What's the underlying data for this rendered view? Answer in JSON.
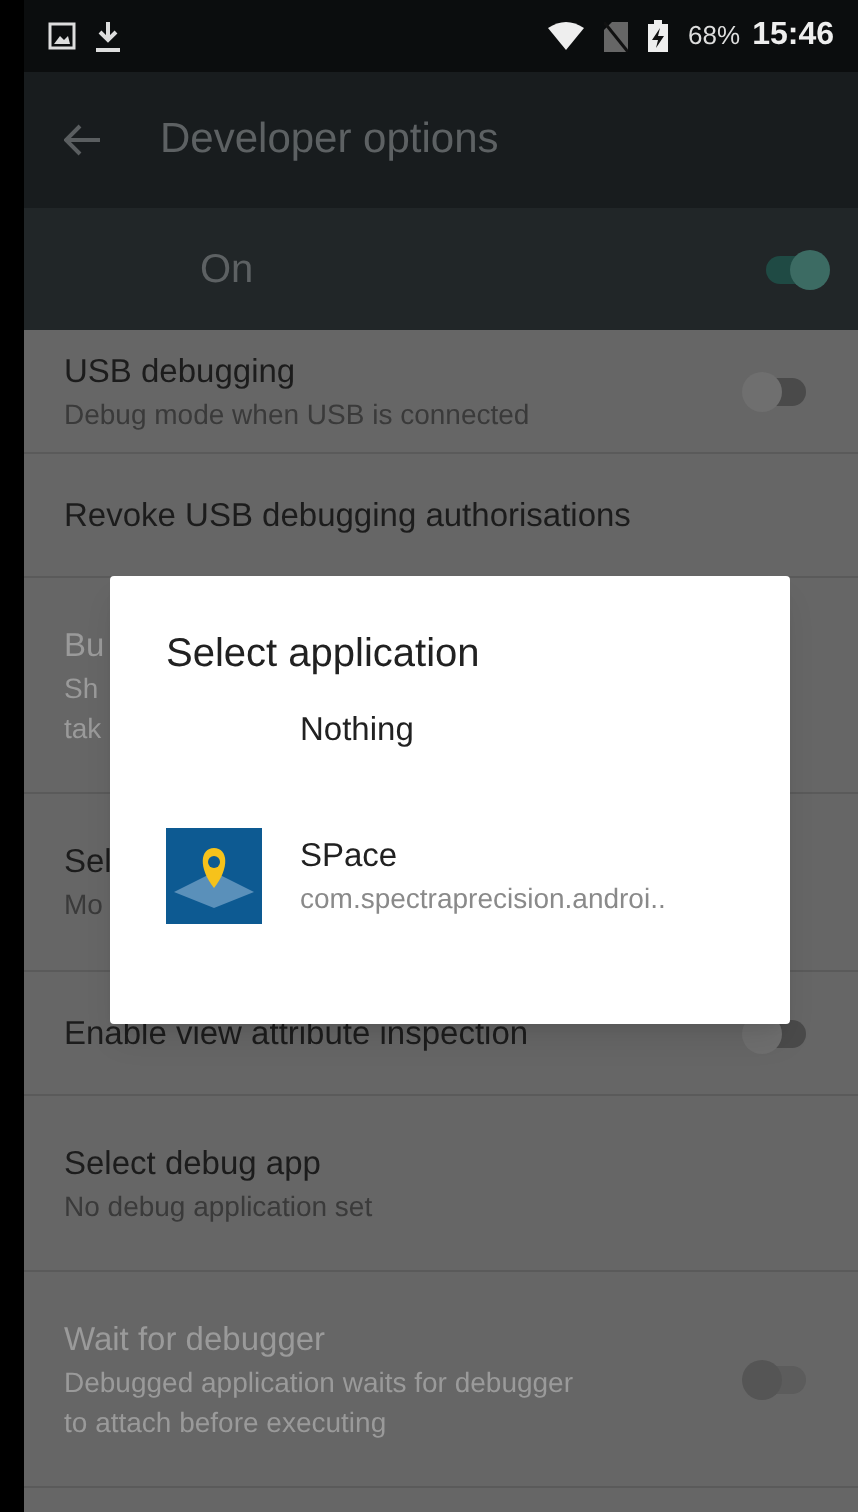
{
  "status_bar": {
    "battery": "68%",
    "time": "15:46"
  },
  "toolbar": {
    "title": "Developer options"
  },
  "master_switch": {
    "label": "On",
    "on": true
  },
  "settings": [
    {
      "kind": "switch",
      "title": "USB debugging",
      "summary": [
        "Debug mode when USB is connected"
      ],
      "on": false,
      "disabled": false
    },
    {
      "kind": "plain",
      "title": "Revoke USB debugging authorisations",
      "disabled": false
    },
    {
      "kind": "covered",
      "title": "Bu",
      "summary": [
        "Sh",
        "tak"
      ],
      "disabled": true
    },
    {
      "kind": "covered",
      "title": "Sel",
      "summary": [
        "Mo"
      ],
      "disabled": false
    },
    {
      "kind": "switch",
      "title": "Enable view attribute inspection",
      "on": false,
      "disabled": false
    },
    {
      "kind": "plain",
      "title": "Select debug app",
      "summary": [
        "No debug application set"
      ],
      "disabled": false
    },
    {
      "kind": "switch",
      "title": "Wait for debugger",
      "summary": [
        "Debugged application waits for debugger",
        "to attach before executing"
      ],
      "on": false,
      "disabled": true
    }
  ],
  "dialog": {
    "title": "Select application",
    "options": [
      {
        "kind": "none",
        "label": "Nothing"
      },
      {
        "kind": "app",
        "label": "SPace",
        "package": "com.spectraprecision.androi.."
      }
    ]
  }
}
